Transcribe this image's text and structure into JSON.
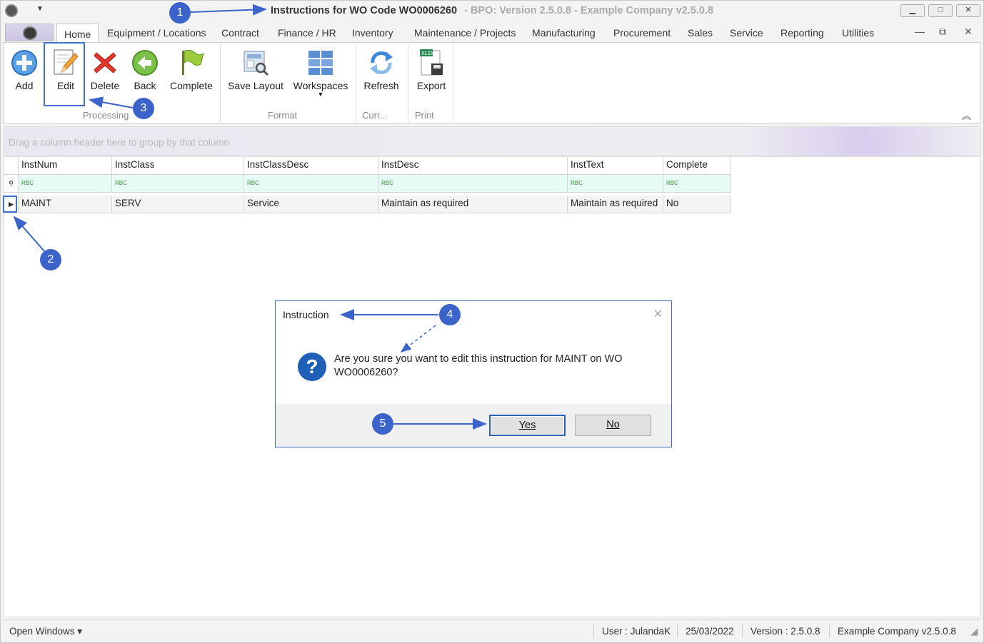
{
  "window": {
    "title": "Instructions for WO Code WO0006260",
    "subtitle": "- BPO: Version 2.5.0.8 - Example Company v2.5.0.8",
    "minimize": "▁",
    "restore": "□",
    "close": "✕"
  },
  "tabs": [
    "Home",
    "Equipment / Locations",
    "Contract",
    "Finance / HR",
    "Inventory",
    "Maintenance / Projects",
    "Manufacturing",
    "Procurement",
    "Sales",
    "Service",
    "Reporting",
    "Utilities"
  ],
  "mdi": {
    "minimize": "—",
    "restore": "⧉",
    "close": "✕"
  },
  "ribbon": {
    "buttons": {
      "add": "Add",
      "edit": "Edit",
      "delete": "Delete",
      "back": "Back",
      "complete": "Complete",
      "save_layout": "Save Layout",
      "workspaces": "Workspaces",
      "refresh": "Refresh",
      "export": "Export"
    },
    "groups": {
      "processing": "Processing",
      "format": "Format",
      "currency": "Curr...",
      "print": "Print"
    }
  },
  "grid": {
    "group_hint": "Drag a column header here to group by that column",
    "columns": [
      "InstNum",
      "InstClass",
      "InstClassDesc",
      "InstDesc",
      "InstText",
      "Complete"
    ],
    "filter_placeholder": "RBC",
    "rows": [
      [
        "MAINT",
        "SERV",
        "Service",
        "Maintain as required",
        "Maintain as required",
        "No"
      ]
    ]
  },
  "dialog": {
    "title": "Instruction",
    "message": "Are you sure you want to edit this instruction for MAINT on WO WO0006260?",
    "yes": "Yes",
    "no": "No"
  },
  "status": {
    "open_windows": "Open Windows ▾",
    "user": "User : JulandaK",
    "date": "25/03/2022",
    "version": "Version : 2.5.0.8",
    "company": "Example Company v2.5.0.8"
  },
  "callouts": [
    "1",
    "2",
    "3",
    "4",
    "5"
  ],
  "colors": {
    "callout": "#3b63c9",
    "highlight": "#4070d0",
    "dialog_border": "#3a6fc4"
  }
}
